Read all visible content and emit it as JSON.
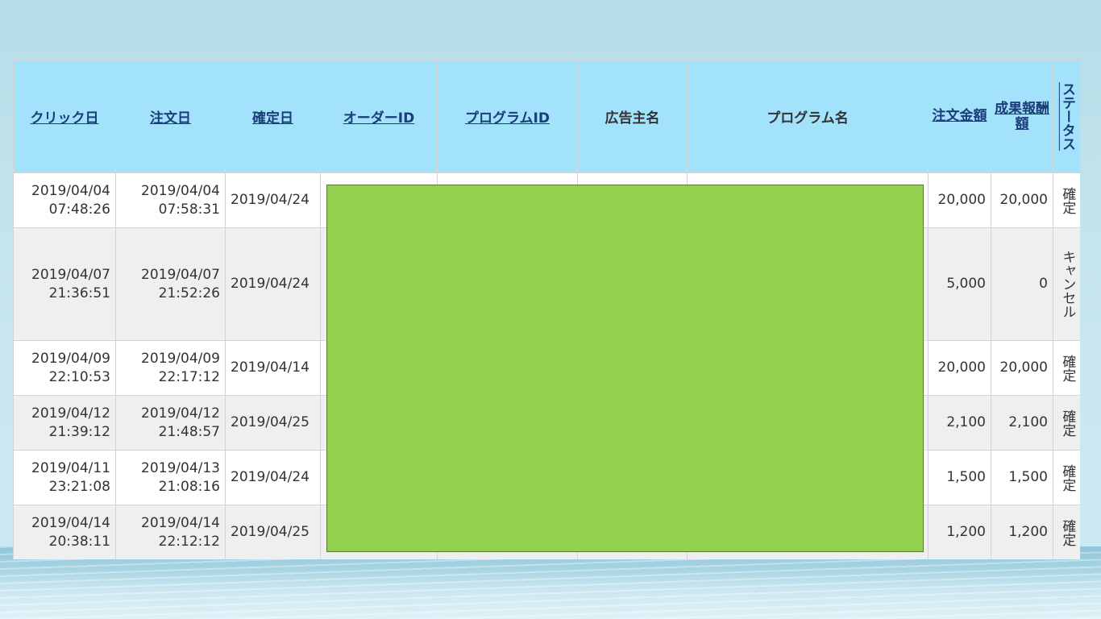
{
  "table": {
    "headers": [
      {
        "label": "クリック日",
        "link": true
      },
      {
        "label": "注文日",
        "link": true
      },
      {
        "label": "確定日",
        "link": true
      },
      {
        "label": "オーダーID",
        "link": true
      },
      {
        "label": "プログラムID",
        "link": true
      },
      {
        "label": "広告主名",
        "link": false
      },
      {
        "label": "プログラム名",
        "link": false
      },
      {
        "label": "注文金額",
        "link": true
      },
      {
        "label": "成果報酬額",
        "link": true
      },
      {
        "label": "ステータス",
        "link": true
      }
    ],
    "rows": [
      {
        "click_date": "2019/04/04",
        "click_time": "07:48:26",
        "order_date": "2019/04/04",
        "order_time": "07:58:31",
        "confirm_date": "2019/04/24",
        "order_id": "",
        "program_id": "",
        "advertiser": "",
        "program_name": "",
        "amount": "20,000",
        "reward": "20,000",
        "status": "確定"
      },
      {
        "click_date": "2019/04/07",
        "click_time": "21:36:51",
        "order_date": "2019/04/07",
        "order_time": "21:52:26",
        "confirm_date": "2019/04/24",
        "order_id": "",
        "program_id": "",
        "advertiser": "",
        "program_name": "",
        "amount": "5,000",
        "reward": "0",
        "status": "キャンセル"
      },
      {
        "click_date": "2019/04/09",
        "click_time": "22:10:53",
        "order_date": "2019/04/09",
        "order_time": "22:17:12",
        "confirm_date": "2019/04/14",
        "order_id": "",
        "program_id": "",
        "advertiser": "",
        "program_name": "",
        "amount": "20,000",
        "reward": "20,000",
        "status": "確定"
      },
      {
        "click_date": "2019/04/12",
        "click_time": "21:39:12",
        "order_date": "2019/04/12",
        "order_time": "21:48:57",
        "confirm_date": "2019/04/25",
        "order_id": "",
        "program_id": "",
        "advertiser": "",
        "program_name": "",
        "amount": "2,100",
        "reward": "2,100",
        "status": "確定"
      },
      {
        "click_date": "2019/04/11",
        "click_time": "23:21:08",
        "order_date": "2019/04/13",
        "order_time": "21:08:16",
        "confirm_date": "2019/04/24",
        "order_id": "",
        "program_id": "",
        "advertiser": "",
        "program_name": "",
        "amount": "1,500",
        "reward": "1,500",
        "status": "確定"
      },
      {
        "click_date": "2019/04/14",
        "click_time": "20:38:11",
        "order_date": "2019/04/14",
        "order_time": "22:12:12",
        "confirm_date": "2019/04/25",
        "order_id": "",
        "program_id": "",
        "advertiser": "",
        "program_name": "",
        "amount": "1,200",
        "reward": "1,200",
        "status": "確定"
      }
    ]
  },
  "colors": {
    "header_bg": "#a3e2fb",
    "header_link": "#1a3c7a",
    "row_alt_bg": "#efefef",
    "redaction": "#92d050",
    "page_bg": "#c4e4ee"
  }
}
